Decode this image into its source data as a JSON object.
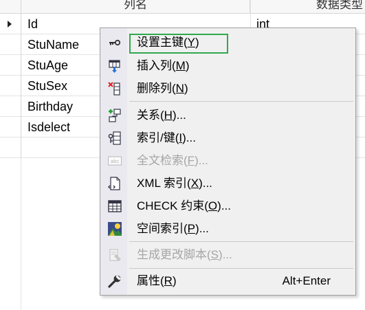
{
  "table": {
    "headers": {
      "column_name": "列名",
      "data_type": "数据类型"
    },
    "rows": [
      {
        "name": "Id",
        "type": "int",
        "current": true
      },
      {
        "name": "StuName",
        "type": ""
      },
      {
        "name": "StuAge",
        "type": ""
      },
      {
        "name": "StuSex",
        "type": ""
      },
      {
        "name": "Birthday",
        "type": ""
      },
      {
        "name": "Isdelect",
        "type": ""
      }
    ]
  },
  "context_menu": {
    "items": [
      {
        "label": "设置主键",
        "mnemonic": "Y",
        "suffix": "",
        "icon": "key-icon",
        "enabled": true,
        "highlighted": true
      },
      {
        "label": "插入列",
        "mnemonic": "M",
        "suffix": "",
        "icon": "insert-column-icon",
        "enabled": true
      },
      {
        "label": "删除列",
        "mnemonic": "N",
        "suffix": "",
        "icon": "delete-column-icon",
        "enabled": true
      },
      {
        "label": "关系",
        "mnemonic": "H",
        "suffix": "...",
        "icon": "relationship-icon",
        "enabled": true
      },
      {
        "label": "索引/键",
        "mnemonic": "I",
        "suffix": "...",
        "icon": "index-key-icon",
        "enabled": true
      },
      {
        "label": "全文检索",
        "mnemonic": "F",
        "suffix": "...",
        "icon": "fulltext-icon",
        "enabled": false
      },
      {
        "label": "XML 索引",
        "mnemonic": "X",
        "suffix": "...",
        "icon": "xml-index-icon",
        "enabled": true
      },
      {
        "label": "CHECK 约束",
        "mnemonic": "O",
        "suffix": "...",
        "icon": "check-constraint-icon",
        "enabled": true
      },
      {
        "label": "空间索引",
        "mnemonic": "P",
        "suffix": "...",
        "icon": "spatial-index-icon",
        "enabled": true
      },
      {
        "label": "生成更改脚本",
        "mnemonic": "S",
        "suffix": "...",
        "icon": "script-icon",
        "enabled": false
      },
      {
        "label": "属性",
        "mnemonic": "R",
        "suffix": "",
        "shortcut": "Alt+Enter",
        "icon": "wrench-icon",
        "enabled": true
      }
    ]
  },
  "colors": {
    "highlight_border": "#2fa84f",
    "disabled_text": "#a6a6a6"
  }
}
